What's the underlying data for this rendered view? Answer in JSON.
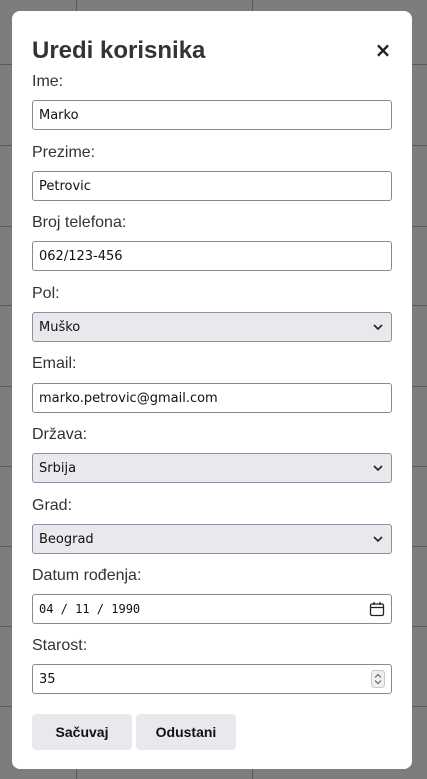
{
  "modal": {
    "title": "Uredi korisnika",
    "close_label": "×"
  },
  "form": {
    "ime": {
      "label": "Ime:",
      "value": "Marko"
    },
    "prezime": {
      "label": "Prezime:",
      "value": "Petrovic"
    },
    "telefon": {
      "label": "Broj telefona:",
      "value": "062/123-456"
    },
    "pol": {
      "label": "Pol:",
      "selected": "Muško"
    },
    "email": {
      "label": "Email:",
      "value": "marko.petrovic@gmail.com"
    },
    "drzava": {
      "label": "Država:",
      "selected": "Srbija"
    },
    "grad": {
      "label": "Grad:",
      "selected": "Beograd"
    },
    "datum": {
      "label": "Datum rođenja:",
      "value": "04 / 11 / 1990"
    },
    "starost": {
      "label": "Starost:",
      "value": "35"
    }
  },
  "actions": {
    "save_label": "Sačuvaj",
    "cancel_label": "Odustani"
  },
  "icons": {
    "close": "close-icon",
    "dropdown": "chevron-down-icon",
    "calendar": "calendar-icon",
    "spinner": "spinner-arrows-icon"
  },
  "colors": {
    "overlay": "#7d7d7d",
    "modal_bg": "#ffffff",
    "select_bg": "#e9e9ed",
    "button_bg": "#e9e9ed",
    "text": "#333333"
  }
}
